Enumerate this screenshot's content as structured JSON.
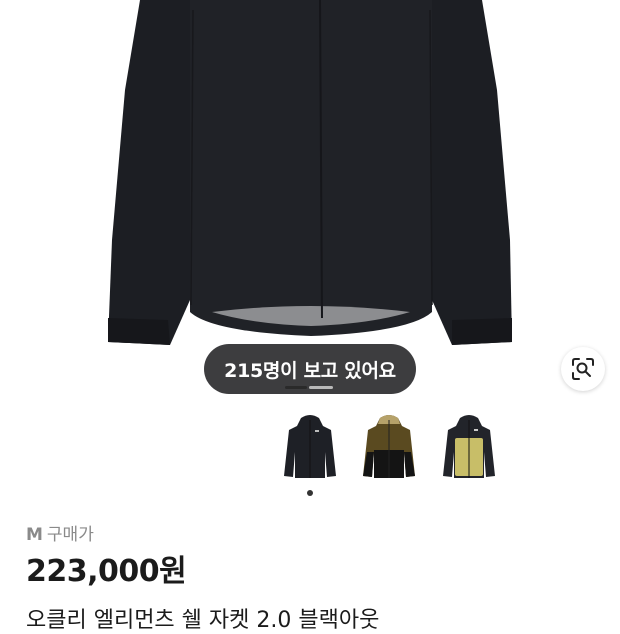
{
  "viewers_badge": "215명이 보고 있어요",
  "gallery": {
    "thumbnails": [
      {
        "name": "black jacket"
      },
      {
        "name": "brown black jacket"
      },
      {
        "name": "olive black jacket"
      }
    ],
    "selected_index": 0
  },
  "product": {
    "size_code": "M",
    "size_price_label": "구매가",
    "price": "223,000원",
    "title": "오클리 엘리먼츠 쉘 자켓 2.0 블랙아웃"
  },
  "colors": {
    "jacket": "#1d1f24",
    "badge_bg": "#222224",
    "text_primary": "#1b1b1b",
    "text_secondary": "#8a8a8a"
  }
}
